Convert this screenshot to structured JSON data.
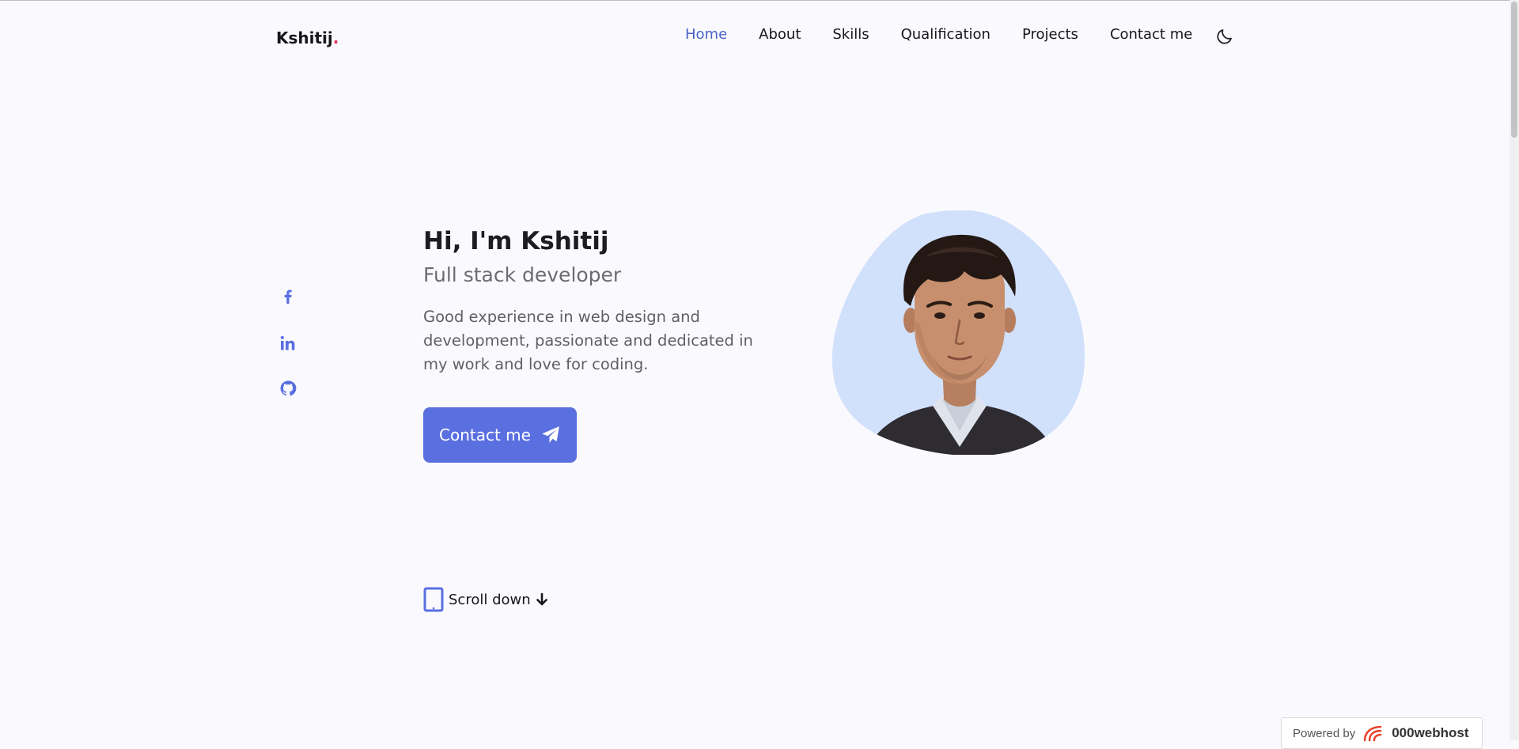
{
  "header": {
    "logo_text": "Kshitij",
    "logo_dot": ".",
    "nav": [
      {
        "label": "Home",
        "active": true
      },
      {
        "label": "About",
        "active": false
      },
      {
        "label": "Skills",
        "active": false
      },
      {
        "label": "Qualification",
        "active": false
      },
      {
        "label": "Projects",
        "active": false
      },
      {
        "label": "Contact me",
        "active": false
      }
    ],
    "theme_icon": "moon-icon"
  },
  "social": [
    {
      "icon": "facebook-icon"
    },
    {
      "icon": "linkedin-icon"
    },
    {
      "icon": "github-icon"
    }
  ],
  "hero": {
    "title": "Hi, I'm Kshitij",
    "subtitle": "Full stack developer",
    "description": "Good experience in web design and development, passionate and dedicated in my work and love for coding.",
    "button_label": "Contact me",
    "button_icon": "send-icon"
  },
  "scroll": {
    "label": "Scroll down",
    "icon": "mouse-icon",
    "arrow_icon": "arrow-down-icon"
  },
  "footer_badge": {
    "powered_label": "Powered by",
    "brand": "000webhost"
  },
  "colors": {
    "accent": "#5a6fe0",
    "active_nav": "#4a63c7",
    "logo_dot": "#e0325a",
    "blob": "#d1e0fb",
    "background": "#fafafe"
  }
}
